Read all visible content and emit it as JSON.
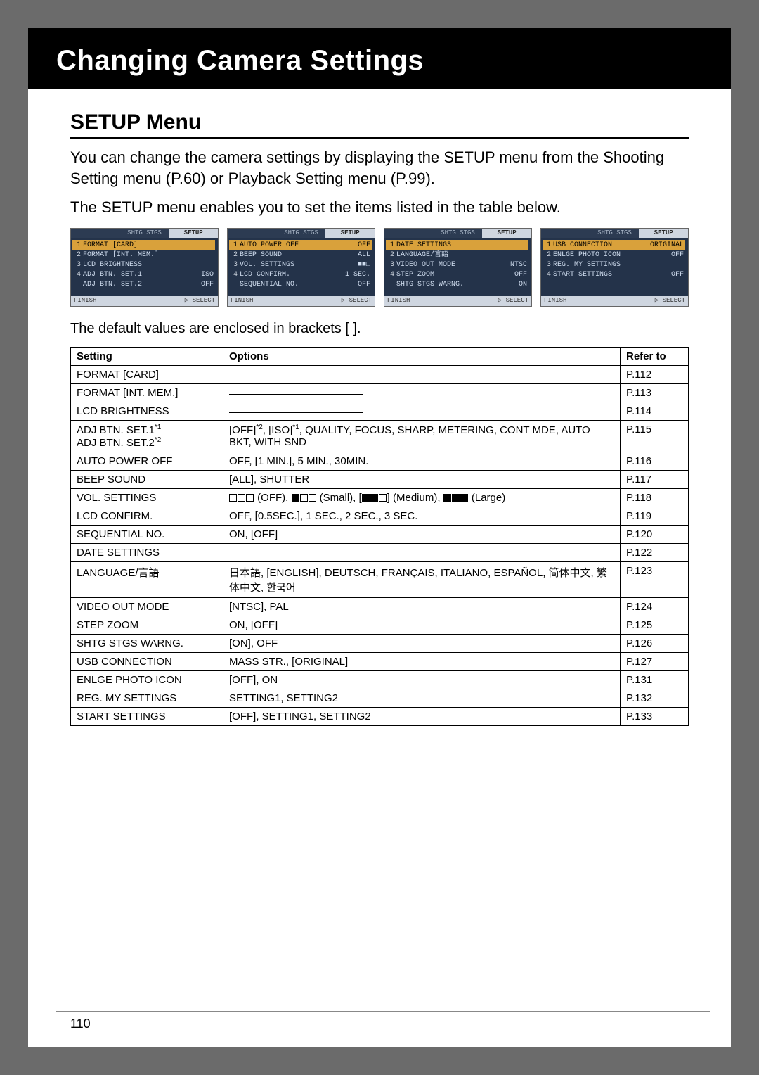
{
  "header": {
    "title": "Changing Camera Settings"
  },
  "section_title": "SETUP Menu",
  "intro_p1": "You can change the camera settings by displaying the SETUP menu from the Shooting Setting menu (P.60) or Playback Setting menu (P.99).",
  "intro_p2": "The SETUP menu enables you to set the items listed in the table below.",
  "defaults_note": "The default values are enclosed in brackets [ ].",
  "page_number": "110",
  "screens": [
    {
      "tabs": [
        "",
        "SHTG STGS",
        "SETUP"
      ],
      "rows": [
        {
          "n": "1",
          "label": "FORMAT [CARD]",
          "val": "",
          "sel": true
        },
        {
          "n": "2",
          "label": "FORMAT [INT. MEM.]",
          "val": ""
        },
        {
          "n": "3",
          "label": "LCD BRIGHTNESS",
          "val": ""
        },
        {
          "n": "4",
          "label": "ADJ BTN. SET.1",
          "val": "ISO"
        },
        {
          "n": "",
          "label": "ADJ BTN. SET.2",
          "val": "OFF"
        }
      ],
      "footer_left": "FINISH",
      "footer_right": "▷ SELECT"
    },
    {
      "tabs": [
        "",
        "SHTG STGS",
        "SETUP"
      ],
      "rows": [
        {
          "n": "1",
          "label": "AUTO POWER OFF",
          "val": "OFF",
          "sel": true
        },
        {
          "n": "2",
          "label": "BEEP SOUND",
          "val": "ALL"
        },
        {
          "n": "3",
          "label": "VOL. SETTINGS",
          "val": "■■□"
        },
        {
          "n": "4",
          "label": "LCD CONFIRM.",
          "val": "1 SEC."
        },
        {
          "n": "",
          "label": "SEQUENTIAL NO.",
          "val": "OFF"
        }
      ],
      "footer_left": "FINISH",
      "footer_right": "▷ SELECT"
    },
    {
      "tabs": [
        "",
        "SHTG STGS",
        "SETUP"
      ],
      "rows": [
        {
          "n": "1",
          "label": "DATE SETTINGS",
          "val": "",
          "sel": true
        },
        {
          "n": "2",
          "label": "LANGUAGE/言語",
          "val": ""
        },
        {
          "n": "3",
          "label": "VIDEO OUT MODE",
          "val": "NTSC"
        },
        {
          "n": "4",
          "label": "STEP ZOOM",
          "val": "OFF"
        },
        {
          "n": "",
          "label": "SHTG STGS WARNG.",
          "val": "ON"
        }
      ],
      "footer_left": "FINISH",
      "footer_right": "▷ SELECT"
    },
    {
      "tabs": [
        "",
        "SHTG STGS",
        "SETUP"
      ],
      "rows": [
        {
          "n": "1",
          "label": "USB CONNECTION",
          "val": "ORIGINAL",
          "sel": true
        },
        {
          "n": "2",
          "label": "ENLGE PHOTO ICON",
          "val": "OFF"
        },
        {
          "n": "3",
          "label": "REG. MY SETTINGS",
          "val": ""
        },
        {
          "n": "4",
          "label": "START SETTINGS",
          "val": "OFF"
        }
      ],
      "footer_left": "FINISH",
      "footer_right": "▷ SELECT"
    }
  ],
  "table": {
    "head": {
      "setting": "Setting",
      "options": "Options",
      "refer": "Refer to"
    },
    "rows": [
      {
        "setting": "FORMAT [CARD]",
        "options_kind": "dash",
        "options": "",
        "refer": "P.112"
      },
      {
        "setting": "FORMAT [INT. MEM.]",
        "options_kind": "dash",
        "options": "",
        "refer": "P.113"
      },
      {
        "setting": "LCD BRIGHTNESS",
        "options_kind": "dash",
        "options": "",
        "refer": "P.114"
      },
      {
        "setting": "ADJ BTN. SET.1*1\nADJ BTN. SET.2*2",
        "options_kind": "text",
        "options": "[OFF]*2, [ISO]*1, QUALITY, FOCUS, SHARP, METERING, CONT MDE, AUTO BKT, WITH SND",
        "refer": "P.115"
      },
      {
        "setting": "AUTO POWER OFF",
        "options_kind": "text",
        "options": "OFF, [1 MIN.], 5 MIN., 30MIN.",
        "refer": "P.116"
      },
      {
        "setting": "BEEP SOUND",
        "options_kind": "text",
        "options": "[ALL], SHUTTER",
        "refer": "P.117"
      },
      {
        "setting": "VOL. SETTINGS",
        "options_kind": "vol",
        "options": "□□□ (OFF), ■□□ (Small), [■■□] (Medium), ■■■ (Large)",
        "refer": "P.118"
      },
      {
        "setting": "LCD CONFIRM.",
        "options_kind": "text",
        "options": "OFF, [0.5SEC.], 1 SEC., 2 SEC., 3 SEC.",
        "refer": "P.119"
      },
      {
        "setting": "SEQUENTIAL NO.",
        "options_kind": "text",
        "options": "ON, [OFF]",
        "refer": "P.120"
      },
      {
        "setting": "DATE SETTINGS",
        "options_kind": "dash",
        "options": "",
        "refer": "P.122"
      },
      {
        "setting": "LANGUAGE/言語",
        "options_kind": "text",
        "options": "日本語, [ENGLISH], DEUTSCH, FRANÇAIS, ITALIANO, ESPAÑOL, 简体中文, 繁体中文, 한국어",
        "refer": "P.123"
      },
      {
        "setting": "VIDEO OUT MODE",
        "options_kind": "text",
        "options": "[NTSC], PAL",
        "refer": "P.124"
      },
      {
        "setting": "STEP ZOOM",
        "options_kind": "text",
        "options": "ON, [OFF]",
        "refer": "P.125"
      },
      {
        "setting": "SHTG STGS WARNG.",
        "options_kind": "text",
        "options": "[ON], OFF",
        "refer": "P.126"
      },
      {
        "setting": "USB CONNECTION",
        "options_kind": "text",
        "options": "MASS STR., [ORIGINAL]",
        "refer": "P.127"
      },
      {
        "setting": "ENLGE PHOTO ICON",
        "options_kind": "text",
        "options": "[OFF], ON",
        "refer": "P.131"
      },
      {
        "setting": "REG. MY SETTINGS",
        "options_kind": "text",
        "options": "SETTING1, SETTING2",
        "refer": "P.132"
      },
      {
        "setting": "START SETTINGS",
        "options_kind": "text",
        "options": "[OFF], SETTING1, SETTING2",
        "refer": "P.133"
      }
    ]
  }
}
